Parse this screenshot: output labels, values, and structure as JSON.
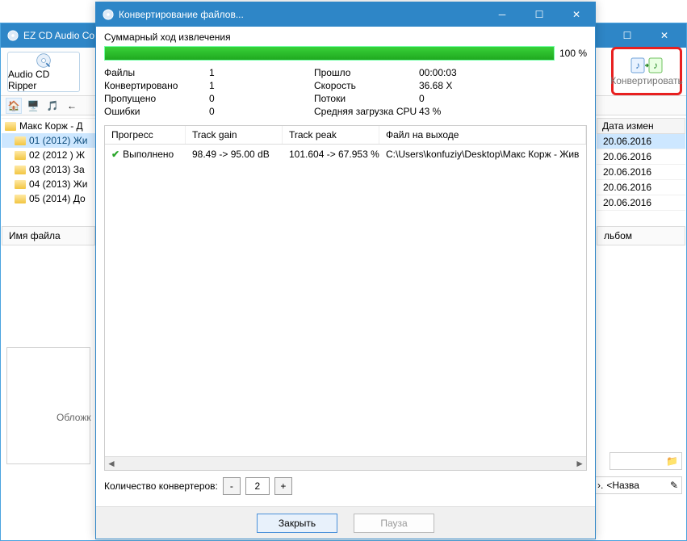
{
  "main": {
    "title": "EZ CD Audio Co",
    "ripper_label": "Audio CD Ripper",
    "convert_label": "Конвертировать",
    "tree_root": "Макс Корж - Д",
    "folders": [
      "01 (2012) Жи",
      "02 (2012 ) Ж",
      "03 (2013) За",
      "04 (2013) Жи",
      "05 (2014) До"
    ],
    "date_header": "Дата измен",
    "dates": [
      "20.06.2016",
      "20.06.2016",
      "20.06.2016",
      "20.06.2016",
      "20.06.2016"
    ],
    "filename_label": "Имя файла",
    "album_label": "льбом",
    "cover_label": "Обложк",
    "template_label": "<Назва"
  },
  "dialog": {
    "title": "Конвертирование файлов...",
    "summary_label": "Суммарный ход извлечения",
    "progress_pct": "100 %",
    "info": {
      "files_label": "Файлы",
      "files_val": "1",
      "converted_label": "Конвертировано",
      "converted_val": "1",
      "skipped_label": "Пропущено",
      "skipped_val": "0",
      "errors_label": "Ошибки",
      "errors_val": "0",
      "elapsed_label": "Прошло",
      "elapsed_val": "00:00:03",
      "speed_label": "Скорость",
      "speed_val": "36.68 X",
      "threads_label": "Потоки",
      "threads_val": "0",
      "cpu_label": "Средняя загрузка CPU",
      "cpu_val": "43 %"
    },
    "columns": {
      "progress": "Прогресс",
      "gain": "Track gain",
      "peak": "Track peak",
      "output": "Файл на выходе"
    },
    "row": {
      "progress": "Выполнено",
      "gain": "98.49 -> 95.00 dB",
      "peak": "101.604 -> 67.953 %",
      "output": "C:\\Users\\konfuziy\\Desktop\\Макс Корж - Жив"
    },
    "converters_label": "Количество конвертеров:",
    "converters_value": "2",
    "close_btn": "Закрыть",
    "pause_btn": "Пауза"
  }
}
